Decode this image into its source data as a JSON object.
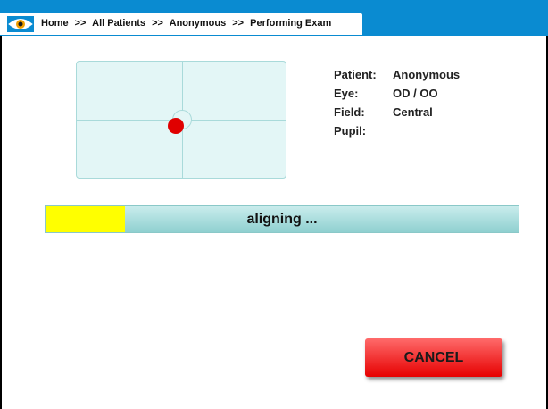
{
  "header": {
    "breadcrumb": [
      "Home",
      "All Patients",
      "Anonymous",
      "Performing Exam"
    ],
    "separator": ">>",
    "accent_color": "#0a8bd1",
    "icon": "eye-logo-icon"
  },
  "alignment_view": {
    "target_color": "#e00000",
    "panel_color": "#e3f6f6"
  },
  "patient_info": {
    "patient_label": "Patient:",
    "patient_value": "Anonymous",
    "eye_label": "Eye:",
    "eye_value": "OD / OO",
    "field_label": "Field:",
    "field_value": "Central",
    "pupil_label": "Pupil:",
    "pupil_value": ""
  },
  "progress": {
    "label": "aligning ...",
    "fraction": 0.167,
    "fill_color": "#ffff00"
  },
  "actions": {
    "cancel_label": "CANCEL",
    "cancel_color": "#e60000"
  }
}
